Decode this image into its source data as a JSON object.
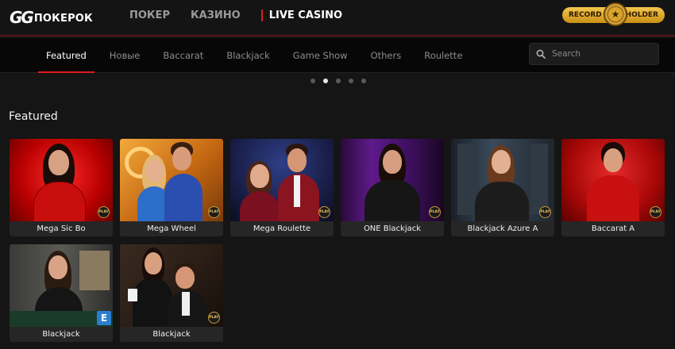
{
  "brand": {
    "logo_mark": "GG",
    "logo_text": "ПОКЕРОК",
    "badge_left": "RECORD",
    "badge_right": "HOLDER"
  },
  "main_nav": [
    {
      "label": "ПОКЕР",
      "active": false
    },
    {
      "label": "КАЗИНО",
      "active": false
    },
    {
      "label": "LIVE CASINO",
      "active": true
    }
  ],
  "tabs": [
    {
      "label": "Featured",
      "active": true
    },
    {
      "label": "Новые",
      "active": false
    },
    {
      "label": "Baccarat",
      "active": false
    },
    {
      "label": "Blackjack",
      "active": false
    },
    {
      "label": "Game Show",
      "active": false
    },
    {
      "label": "Others",
      "active": false
    },
    {
      "label": "Roulette",
      "active": false
    }
  ],
  "search": {
    "placeholder": "Search",
    "icon": "search-icon"
  },
  "carousel": {
    "dot_count": 5,
    "active_index": 1
  },
  "section": {
    "title": "Featured"
  },
  "games": [
    {
      "title": "Mega Sic Bo",
      "badge": "PLAY"
    },
    {
      "title": "Mega Wheel",
      "badge": "PLAY"
    },
    {
      "title": "Mega Roulette",
      "badge": "PLAY"
    },
    {
      "title": "ONE Blackjack",
      "badge": "PLAY"
    },
    {
      "title": "Blackjack Azure A",
      "badge": "PLAY"
    },
    {
      "title": "Baccarat A",
      "badge": "PLAY"
    },
    {
      "title": "Blackjack",
      "badge": "E"
    },
    {
      "title": "Blackjack",
      "badge": "PLAY"
    }
  ],
  "colors": {
    "accent": "#e21c1c",
    "background": "#151515",
    "badge_gold": "#f4c64e"
  }
}
